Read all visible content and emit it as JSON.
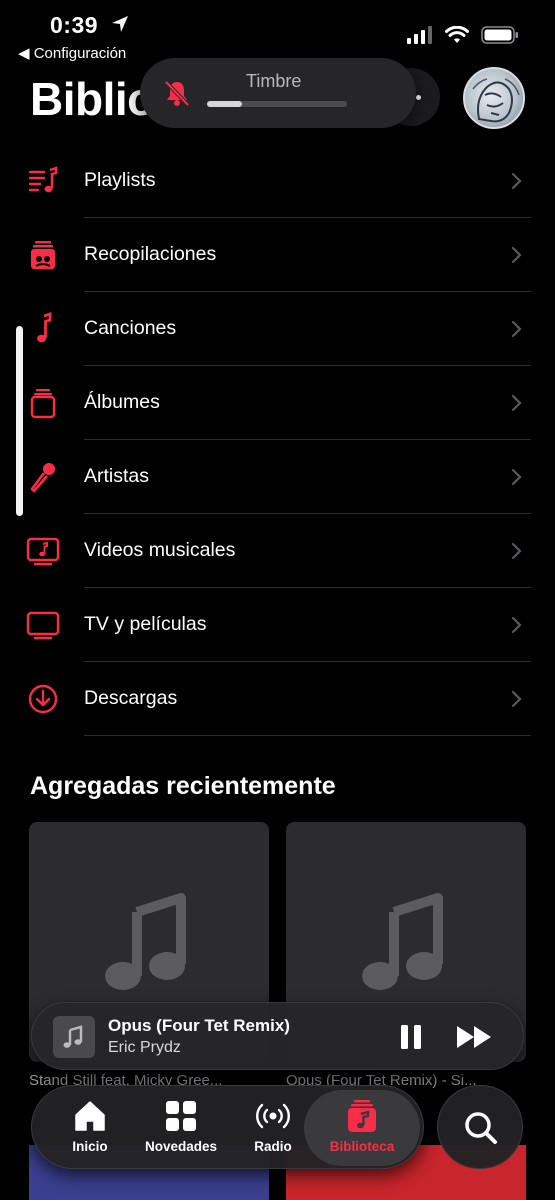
{
  "status_bar": {
    "time": "0:39",
    "back_label": "◀ Configuración"
  },
  "header": {
    "title": "Bibliot"
  },
  "ringer_hud": {
    "label": "Timbre",
    "level": 0.25
  },
  "menu": {
    "items": [
      {
        "label": "Playlists",
        "icon": "playlist-icon"
      },
      {
        "label": "Recopilaciones",
        "icon": "compilation-icon"
      },
      {
        "label": "Canciones",
        "icon": "music-note-icon"
      },
      {
        "label": "Álbumes",
        "icon": "album-icon"
      },
      {
        "label": "Artistas",
        "icon": "microphone-icon"
      },
      {
        "label": "Videos musicales",
        "icon": "music-video-icon"
      },
      {
        "label": "TV y películas",
        "icon": "tv-icon"
      },
      {
        "label": "Descargas",
        "icon": "download-icon"
      }
    ]
  },
  "recently_added": {
    "title": "Agregadas recientemente",
    "items": [
      {
        "caption": "Stand Still feat. Micky Gree..."
      },
      {
        "caption": "Opus (Four Tet Remix) - Si..."
      }
    ]
  },
  "now_playing": {
    "title": "Opus (Four Tet Remix)",
    "artist": "Eric Prydz"
  },
  "tabbar": {
    "tabs": [
      {
        "label": "Inicio",
        "icon": "home-icon"
      },
      {
        "label": "Novedades",
        "icon": "grid-icon"
      },
      {
        "label": "Radio",
        "icon": "radio-icon"
      },
      {
        "label": "Biblioteca",
        "icon": "library-icon",
        "active": true
      }
    ]
  },
  "colors": {
    "accent": "#fa2d48",
    "background": "#000000",
    "surface": "#1c1c1e",
    "divider": "#2c2c2e",
    "secondary_text": "#9a9a9e"
  }
}
